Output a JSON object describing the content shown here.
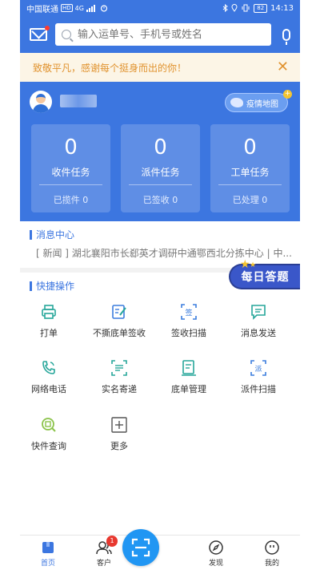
{
  "status_bar": {
    "carrier": "中国联通",
    "hd_badge": "HD",
    "network": "4G",
    "battery": "82",
    "time": "14:13"
  },
  "search": {
    "placeholder": "输入运单号、手机号或姓名"
  },
  "notice": {
    "text": "致敬平凡，感谢每个挺身而出的你！",
    "close_glyph": "✕"
  },
  "header": {
    "map_button_label": "疫情地图"
  },
  "task_cards": [
    {
      "count": "0",
      "label": "收件任务",
      "sub": "已揽件 0"
    },
    {
      "count": "0",
      "label": "派件任务",
      "sub": "已签收 0"
    },
    {
      "count": "0",
      "label": "工单任务",
      "sub": "已处理 0"
    }
  ],
  "news": {
    "title": "消息中心",
    "item": "[ 新闻 ] 湖北襄阳市长郄英才调研中通鄂西北分拣中心 | 中..."
  },
  "daily_quiz": {
    "label": "每日答题"
  },
  "quick_actions": {
    "title": "快捷操作",
    "items": [
      {
        "label": "打单",
        "icon": "printer-icon"
      },
      {
        "label": "不撕底单签收",
        "icon": "sign-edit-icon"
      },
      {
        "label": "签收扫描",
        "icon": "sign-scan-icon"
      },
      {
        "label": "消息发送",
        "icon": "message-icon"
      },
      {
        "label": "网络电话",
        "icon": "phone-icon"
      },
      {
        "label": "实名寄递",
        "icon": "real-name-icon"
      },
      {
        "label": "底单管理",
        "icon": "receipt-manage-icon"
      },
      {
        "label": "派件扫描",
        "icon": "dispatch-scan-icon"
      },
      {
        "label": "快件查询",
        "icon": "parcel-search-icon"
      },
      {
        "label": "更多",
        "icon": "more-icon"
      }
    ]
  },
  "bottom_nav": [
    {
      "label": "首页",
      "icon": "home-icon",
      "active": true
    },
    {
      "label": "客户",
      "icon": "customers-icon",
      "badge": "1"
    },
    {
      "label": "",
      "icon": "scan-icon"
    },
    {
      "label": "发现",
      "icon": "discover-icon"
    },
    {
      "label": "我的",
      "icon": "profile-icon"
    }
  ],
  "colors": {
    "primary": "#3c76e0",
    "notice_text": "#e0922e",
    "notice_bg": "#fcf5e6",
    "icon_teal": "#26a69a",
    "icon_blue": "#3b7ddd",
    "badge_red": "#e8382f"
  }
}
